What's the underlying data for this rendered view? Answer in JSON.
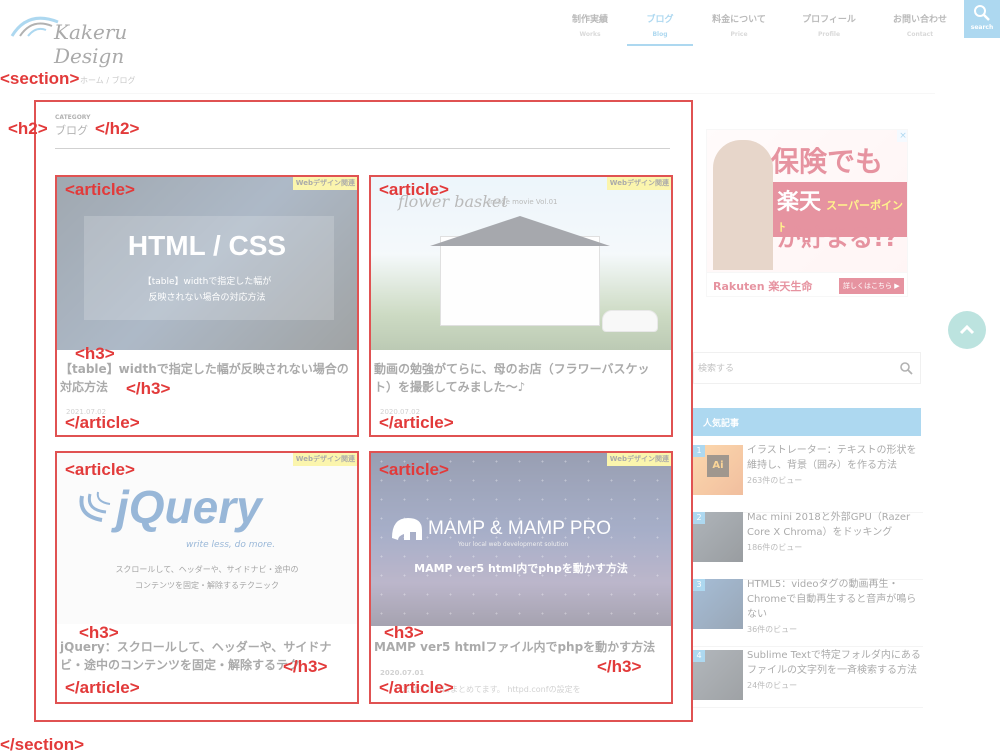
{
  "header": {
    "logo_text": "Kakeru Design",
    "nav": [
      {
        "label": "制作実績",
        "sub": "Works"
      },
      {
        "label": "ブログ",
        "sub": "Blog",
        "active": true
      },
      {
        "label": "料金について",
        "sub": "Price"
      },
      {
        "label": "プロフィール",
        "sub": "Profile"
      },
      {
        "label": "お問い合わせ",
        "sub": "Contact"
      }
    ],
    "search_label": "search"
  },
  "breadcrumb": {
    "home": "ホーム",
    "sep": "/",
    "current": "ブログ"
  },
  "category": {
    "caption": "CATEGORY",
    "title": "ブログ"
  },
  "cards": [
    {
      "badge": "Webデザイン関連",
      "img_title": "HTML / CSS",
      "img_sub1": "【table】widthで指定した幅が",
      "img_sub2": "反映されない場合の対応方法",
      "title": "【table】widthで指定した幅が反映されない場合の対応方法",
      "date": "2021.07.02"
    },
    {
      "badge": "Webデザイン関連",
      "img_brand": "flower basket",
      "img_caption": "Image movie Vol.01",
      "title": "動画の勉強がてらに、母のお店（フラワーバスケット）を撮影してみました～♪",
      "date": "2020.07.02"
    },
    {
      "badge": "Webデザイン関連",
      "img_logo": "jQuery",
      "img_tagline": "write less, do more.",
      "img_sub1": "スクロールして、ヘッダーや、サイドナビ・途中の",
      "img_sub2": "コンテンツを固定・解除するテクニック",
      "title": "jQuery：スクロールして、ヘッダーや、サイドナビ・途中のコンテンツを固定・解除するテク",
      "date": ""
    },
    {
      "badge": "Webデザイン関連",
      "img_logo": "MAMP & MAMP PRO",
      "img_tagline": "Your local web development solution",
      "img_sub": "MAMP ver5 html内でphpを動かす方法",
      "title": "MAMP ver5 htmlファイル内でphpを動かす方法",
      "date": "2020.07.01",
      "excerpt": "…法はこちらにまとめてます。 httpd.confの設定を"
    }
  ],
  "ad": {
    "line1": "保険でも",
    "line2a": "楽天",
    "line2b": "スーパーポイント",
    "line3": "が貯まる!?",
    "brand": "Rakuten 楽天生命",
    "cta": "詳しくはこちら ▶",
    "close": "×"
  },
  "sidebar": {
    "search_placeholder": "検索する",
    "popular_heading": "人気記事",
    "items": [
      {
        "num": "1",
        "title": "イラストレーター：テキストの形状を維持し、背景（囲み）を作る方法",
        "views": "263件のビュー"
      },
      {
        "num": "2",
        "title": "Mac mini 2018と外部GPU（Razer Core X Chroma）をドッキング",
        "views": "186件のビュー"
      },
      {
        "num": "3",
        "title": "HTML5：videoタグの動画再生・Chromeで自動再生すると音声が鳴らない",
        "views": "36件のビュー"
      },
      {
        "num": "4",
        "title": "Sublime Textで特定フォルダ内にあるファイルの文字列を一斉検索する方法",
        "views": "24件のビュー"
      }
    ]
  },
  "annotations": {
    "section_open": "<section>",
    "section_close": "</section>",
    "h2_open": "<h2>",
    "h2_close": "</h2>",
    "article_open": "<article>",
    "article_close": "</article>",
    "h3_open": "<h3>",
    "h3_close": "</h3>"
  },
  "colors": {
    "accent": "#4aa8de",
    "badge": "#f6e84b",
    "annotation": "#e23a3a",
    "pagetop": "#6cc0b8"
  }
}
